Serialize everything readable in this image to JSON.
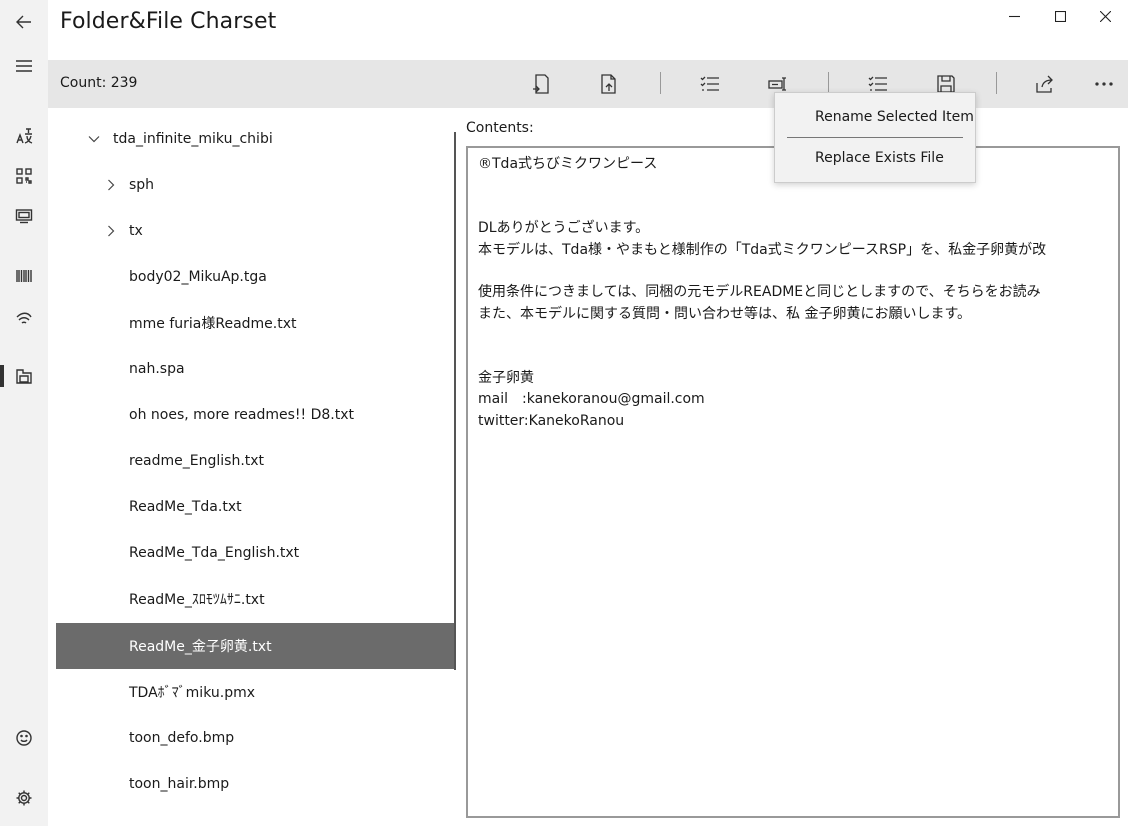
{
  "window": {
    "title": "Folder&File Charset"
  },
  "toolbar": {
    "count_label": "Count: 239"
  },
  "tree": {
    "items": [
      {
        "label": "tda_infinite_miku_chibi",
        "expanded": true
      },
      {
        "label": "sph",
        "expanded": false
      },
      {
        "label": "tx",
        "expanded": false
      },
      {
        "label": "body02_MikuAp.tga"
      },
      {
        "label": "mme furia様Readme.txt"
      },
      {
        "label": "nah.spa"
      },
      {
        "label": "oh noes, more readmes!! D8.txt"
      },
      {
        "label": "readme_English.txt"
      },
      {
        "label": "ReadMe_Tda.txt"
      },
      {
        "label": "ReadMe_Tda_English.txt"
      },
      {
        "label": "ReadMe_ｽﾛﾓﾂﾑｻﾆ.txt"
      },
      {
        "label": "ReadMe_金子卵黄.txt",
        "selected": true
      },
      {
        "label": "TDAﾎﾞﾏﾞmiku.pmx"
      },
      {
        "label": "toon_defo.bmp"
      },
      {
        "label": "toon_hair.bmp"
      }
    ]
  },
  "contents": {
    "label": "Contents:",
    "text": "®Tda式ちびミクワンピース\n\n\nDLありがとうございます。\n本モデルは、Tda様・やまもと様制作の「Tda式ミクワンピースRSP」を、私金子卵黄が改\n\n使用条件につきましては、同梱の元モデルREADMEと同じとしますので、そちらをお読み\nまた、本モデルに関する質問・問い合わせ等は、私 金子卵黄にお願いします。\n\n\n金子卵黄\nmail　:kanekoranou@gmail.com\ntwitter:KanekoRanou"
  },
  "menu": {
    "items": [
      {
        "label": "Rename Selected Item"
      },
      {
        "label": "Replace Exists File"
      }
    ]
  },
  "colors": {
    "rail_bg": "#f2f2f2",
    "toolbar_bg": "#e6e6e6",
    "selected_bg": "#6b6b6b",
    "menu_bg": "#f2f2f2"
  }
}
